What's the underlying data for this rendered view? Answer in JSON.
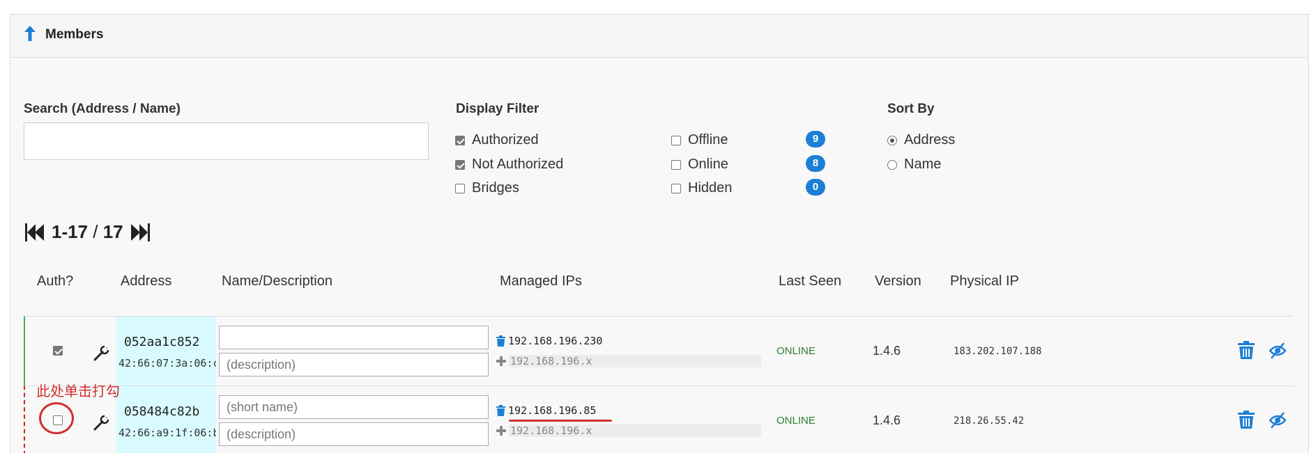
{
  "header": {
    "title": "Members"
  },
  "search": {
    "label": "Search (Address / Name)",
    "value": "",
    "placeholder": ""
  },
  "display_filter": {
    "label": "Display Filter",
    "col1": [
      {
        "label": "Authorized",
        "checked": true
      },
      {
        "label": "Not Authorized",
        "checked": true
      },
      {
        "label": "Bridges",
        "checked": false
      }
    ],
    "col2": [
      {
        "label": "Offline",
        "checked": false,
        "count": "9"
      },
      {
        "label": "Online",
        "checked": false,
        "count": "8"
      },
      {
        "label": "Hidden",
        "checked": false,
        "count": "0"
      }
    ]
  },
  "sort_by": {
    "label": "Sort By",
    "options": [
      {
        "label": "Address",
        "selected": true
      },
      {
        "label": "Name",
        "selected": false
      }
    ]
  },
  "pager": {
    "range": "1-17",
    "separator": " / ",
    "total": "17"
  },
  "table": {
    "headers": {
      "auth": "Auth?",
      "address": "Address",
      "name": "Name/Description",
      "ips": "Managed IPs",
      "last_seen": "Last Seen",
      "version": "Version",
      "physical_ip": "Physical IP"
    },
    "rows": [
      {
        "authorized": true,
        "address": "052aa1c852",
        "mac": "42:66:07:3a:06:c",
        "name": "",
        "name_placeholder": "",
        "description": "",
        "description_placeholder": "(description)",
        "ip": "192.168.196.230",
        "ip_add_placeholder": "192.168.196.x",
        "status": "ONLINE",
        "version": "1.4.6",
        "physical_ip": "183.202.107.188"
      },
      {
        "authorized": false,
        "address": "058484c82b",
        "mac": "42:66:a9:1f:06:b",
        "name": "",
        "name_placeholder": "(short name)",
        "description": "",
        "description_placeholder": "(description)",
        "ip": "192.168.196.85",
        "ip_add_placeholder": "192.168.196.x",
        "status": "ONLINE",
        "version": "1.4.6",
        "physical_ip": "218.26.55.42"
      }
    ]
  },
  "annotation": {
    "text": "此处单击打勾"
  },
  "colors": {
    "accent": "#1c7fd6",
    "online": "#2e7d32",
    "annotation": "#d32f2f",
    "address_bg": "#d9fbff"
  }
}
